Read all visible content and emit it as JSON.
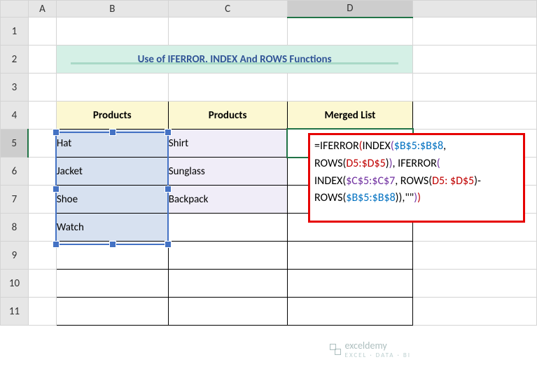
{
  "columns": {
    "A": "A",
    "B": "B",
    "C": "C",
    "D": "D"
  },
  "rows": {
    "r1": "1",
    "r2": "2",
    "r3": "3",
    "r4": "4",
    "r5": "5",
    "r6": "6",
    "r7": "7",
    "r8": "8",
    "r9": "9",
    "r10": "10",
    "r11": "11"
  },
  "title": "Use of IFERROR, INDEX And ROWS Functions",
  "headers": {
    "b4": "Products",
    "c4": "Products",
    "d4": "Merged List"
  },
  "colB": {
    "r5": "Hat",
    "r6": "Jacket",
    "r7": "Shoe",
    "r8": "Watch"
  },
  "colC": {
    "r5": "Shirt",
    "r6": "Sunglass",
    "r7": "Backpack"
  },
  "formula": {
    "eq": "=",
    "iferror": "IFERROR",
    "op": "(",
    "cp": ")",
    "comma": ", ",
    "comma2": ",",
    "index": "INDEX",
    "rows": "ROWS",
    "rngB": "$B$5:$B$8",
    "rngB2": "$B$5:$B$8",
    "rngC": "$C$5:$C$7",
    "d1": "D5:$D$5",
    "d2": "D5:",
    "d3": "$D$5",
    "minus": "-",
    "empty": "\"\""
  },
  "watermark": {
    "name": "exceldemy",
    "tag": "EXCEL · DATA · BI"
  }
}
